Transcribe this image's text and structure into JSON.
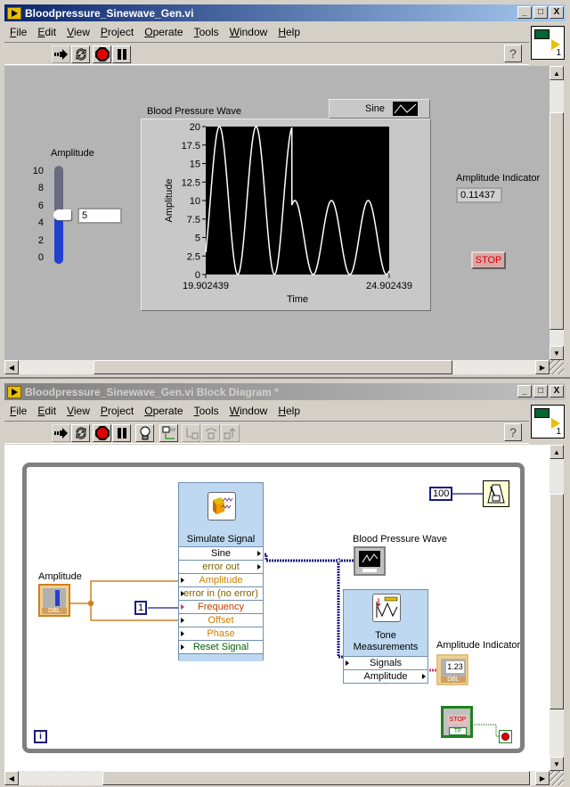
{
  "front_panel": {
    "title": "Bloodpressure_Sinewave_Gen.vi",
    "menu": [
      "File",
      "Edit",
      "View",
      "Project",
      "Operate",
      "Tools",
      "Window",
      "Help"
    ],
    "window_buttons": {
      "minimize": "_",
      "maximize": "□",
      "close": "X"
    },
    "toolbar": [
      "run-icon",
      "run-continuously-icon",
      "abort-icon",
      "pause-icon"
    ],
    "help_label": "?",
    "connector_pane_number": "1",
    "amplitude_control": {
      "label": "Amplitude",
      "scale": [
        "10",
        "8",
        "6",
        "4",
        "2",
        "0"
      ],
      "min": 0,
      "max": 10,
      "value": "5"
    },
    "graph": {
      "title": "Blood Pressure Wave",
      "legend_label": "Sine",
      "ylabel": "Amplitude",
      "xlabel": "Time",
      "yticks": [
        "20",
        "17.5",
        "15",
        "12.5",
        "10",
        "7.5",
        "5",
        "2.5",
        "0"
      ],
      "xmin_label": "19.902439",
      "xmax_label": "24.902439"
    },
    "amplitude_indicator": {
      "label": "Amplitude Indicator",
      "value": "0.11437"
    },
    "stop_button": "STOP"
  },
  "chart_data": {
    "type": "line",
    "title": "Blood Pressure Wave",
    "xlabel": "Time",
    "ylabel": "Amplitude",
    "xlim": [
      19.902439,
      24.902439
    ],
    "ylim": [
      0,
      20
    ],
    "legend": [
      "Sine"
    ],
    "series": [
      {
        "name": "Sine",
        "segments": [
          {
            "x_start": 19.902439,
            "x_end": 22.25,
            "offset": 10,
            "amplitude": 10,
            "cycles_per_unit": 1.0,
            "phase_start_value": 3
          },
          {
            "x_start": 22.25,
            "x_end": 24.902439,
            "offset": 5,
            "amplitude": 5,
            "cycles_per_unit": 1.0,
            "start_value": 10
          }
        ]
      }
    ]
  },
  "block_diagram": {
    "title": "Bloodpressure_Sinewave_Gen.vi Block Diagram *",
    "menu": [
      "File",
      "Edit",
      "View",
      "Project",
      "Operate",
      "Tools",
      "Window",
      "Help"
    ],
    "help_label": "?",
    "connector_pane_number": "1",
    "toolbar": [
      "run-icon",
      "run-continuously-icon",
      "abort-icon",
      "pause-icon",
      "highlight-execution-icon",
      "retain-wire-values-icon",
      "step-into-icon",
      "step-over-icon",
      "step-out-icon"
    ],
    "amplitude_terminal": {
      "label": "Amplitude",
      "type": "DBL"
    },
    "frequency_constant": "1",
    "wait_constant": "100",
    "simulate_signal": {
      "title": "Simulate Signal",
      "terminals": [
        {
          "label": "Sine",
          "color": "#000000"
        },
        {
          "label": "error out",
          "color": "#806000"
        },
        {
          "label": "Amplitude",
          "color": "#d08000"
        },
        {
          "label": "error in (no error)",
          "color": "#806000"
        },
        {
          "label": "Frequency",
          "color": "#c04000"
        },
        {
          "label": "Offset",
          "color": "#d08000"
        },
        {
          "label": "Phase",
          "color": "#d08000"
        },
        {
          "label": "Reset Signal",
          "color": "#006000"
        }
      ]
    },
    "graph_terminal": {
      "label": "Blood Pressure Wave"
    },
    "tone_measurements": {
      "title_line1": "Tone",
      "title_line2": "Measurements",
      "terminals": [
        "Signals",
        "Amplitude"
      ]
    },
    "amplitude_indicator_terminal": {
      "label": "Amplitude Indicator",
      "value": "1.23",
      "type": "DBL"
    },
    "stop_terminal": {
      "label": "STOP",
      "type": "TF"
    },
    "iteration_terminal": "i"
  }
}
